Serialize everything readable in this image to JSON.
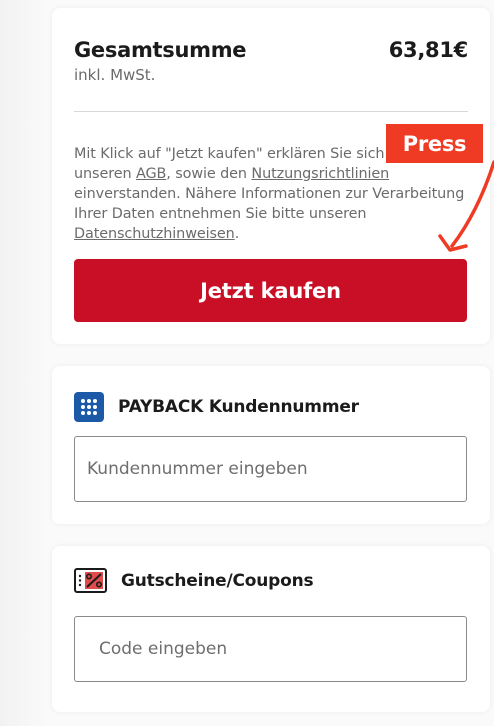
{
  "total": {
    "label": "Gesamtsumme",
    "sub": "inkl. MwSt.",
    "amount": "63,81€"
  },
  "legal": {
    "part1": "Mit Klick auf \"Jetzt kaufen\" erklären Sie sich mit unseren ",
    "agb": "AGB",
    "part2": ", sowie den ",
    "nutzung": "Nutzungsrichtlinien",
    "part3": " einverstanden. Nähere Informationen zur Verarbeitung Ihrer Daten entnehmen Sie bitte unseren ",
    "datenschutz": "Datenschutzhinweisen",
    "part4": "."
  },
  "buy_button": {
    "label": "Jetzt kaufen"
  },
  "annotation": {
    "label": "Press",
    "color": "#ef3b24"
  },
  "payback": {
    "title": "PAYBACK Kundennummer",
    "placeholder": "Kundennummer eingeben",
    "icon": "payback-grid-icon"
  },
  "coupon": {
    "title": "Gutscheine/Coupons",
    "placeholder": "Code eingeben",
    "icon": "coupon-percent-icon"
  },
  "colors": {
    "accent": "#c90f25",
    "payback": "#1c5aa8"
  }
}
